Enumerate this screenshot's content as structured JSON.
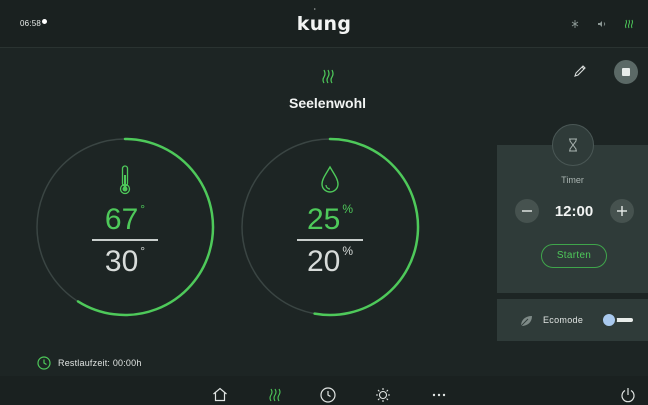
{
  "header": {
    "time": "06:58",
    "logo": "kung",
    "status_icons": [
      "bluetooth-icon",
      "volume-icon",
      "heat-waves-icon"
    ]
  },
  "program": {
    "icon": "heat-waves-icon",
    "name": "Seelenwohl"
  },
  "temperature": {
    "icon": "thermometer-icon",
    "target": "67",
    "actual": "30",
    "unit": "°",
    "target_fraction": 0.67,
    "actual_fraction": 0.3
  },
  "humidity": {
    "icon": "droplet-icon",
    "target": "25",
    "actual": "20",
    "unit": "%",
    "target_fraction": 0.6,
    "actual_fraction": 0.2
  },
  "timer": {
    "icon": "hourglass-icon",
    "label": "Timer",
    "value": "12:00",
    "minus_label": "−",
    "plus_label": "+",
    "start_label": "Starten"
  },
  "ecomode": {
    "icon": "leaf-icon",
    "label": "Ecomode",
    "enabled": false
  },
  "remaining": {
    "icon": "clock-icon",
    "text": "Restlaufzeit: 00:00h"
  },
  "nav": {
    "items": [
      "home-icon",
      "heat-waves-icon",
      "clock-icon",
      "light-icon",
      "more-icon"
    ],
    "power": "power-icon"
  },
  "colors": {
    "accent": "#4ec95a",
    "background": "#1d2524",
    "panel": "#2f3b39"
  }
}
